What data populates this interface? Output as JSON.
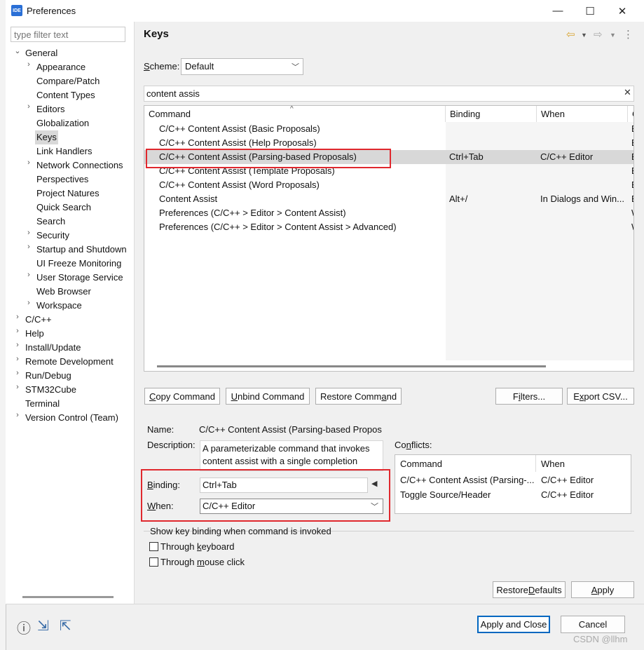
{
  "window": {
    "title": "Preferences",
    "app_icon_text": "IDE",
    "minimize": "—",
    "maximize": "☐",
    "close": "✕"
  },
  "filter": {
    "placeholder": "type filter text"
  },
  "tree": [
    {
      "label": "General",
      "level": 0,
      "twisty": "expanded"
    },
    {
      "label": "Appearance",
      "level": 1,
      "twisty": "collapsed"
    },
    {
      "label": "Compare/Patch",
      "level": 1,
      "twisty": "none"
    },
    {
      "label": "Content Types",
      "level": 1,
      "twisty": "none"
    },
    {
      "label": "Editors",
      "level": 1,
      "twisty": "collapsed"
    },
    {
      "label": "Globalization",
      "level": 1,
      "twisty": "none"
    },
    {
      "label": "Keys",
      "level": 1,
      "twisty": "none",
      "selected": true
    },
    {
      "label": "Link Handlers",
      "level": 1,
      "twisty": "none"
    },
    {
      "label": "Network Connections",
      "level": 1,
      "twisty": "collapsed"
    },
    {
      "label": "Perspectives",
      "level": 1,
      "twisty": "none"
    },
    {
      "label": "Project Natures",
      "level": 1,
      "twisty": "none"
    },
    {
      "label": "Quick Search",
      "level": 1,
      "twisty": "none"
    },
    {
      "label": "Search",
      "level": 1,
      "twisty": "none"
    },
    {
      "label": "Security",
      "level": 1,
      "twisty": "collapsed"
    },
    {
      "label": "Startup and Shutdown",
      "level": 1,
      "twisty": "collapsed"
    },
    {
      "label": "UI Freeze Monitoring",
      "level": 1,
      "twisty": "none"
    },
    {
      "label": "User Storage Service",
      "level": 1,
      "twisty": "collapsed"
    },
    {
      "label": "Web Browser",
      "level": 1,
      "twisty": "none"
    },
    {
      "label": "Workspace",
      "level": 1,
      "twisty": "collapsed"
    },
    {
      "label": "C/C++",
      "level": 0,
      "twisty": "collapsed"
    },
    {
      "label": "Help",
      "level": 0,
      "twisty": "collapsed"
    },
    {
      "label": "Install/Update",
      "level": 0,
      "twisty": "collapsed"
    },
    {
      "label": "Remote Development",
      "level": 0,
      "twisty": "collapsed"
    },
    {
      "label": "Run/Debug",
      "level": 0,
      "twisty": "collapsed"
    },
    {
      "label": "STM32Cube",
      "level": 0,
      "twisty": "collapsed"
    },
    {
      "label": "Terminal",
      "level": 0,
      "twisty": "none"
    },
    {
      "label": "Version Control (Team)",
      "level": 0,
      "twisty": "collapsed"
    }
  ],
  "page": {
    "title": "Keys"
  },
  "scheme": {
    "label_pre": "",
    "label_u": "S",
    "label_post": "cheme:",
    "value": "Default"
  },
  "search": {
    "value": "content assis"
  },
  "table": {
    "headers": [
      "Command",
      "Binding",
      "When",
      "C"
    ],
    "rows": [
      {
        "command": "C/C++ Content Assist (Basic Proposals)",
        "binding": "",
        "when": "",
        "cat": "E"
      },
      {
        "command": "C/C++ Content Assist (Help Proposals)",
        "binding": "",
        "when": "",
        "cat": "E"
      },
      {
        "command": "C/C++ Content Assist (Parsing-based Proposals)",
        "binding": "Ctrl+Tab",
        "when": "C/C++ Editor",
        "cat": "E"
      },
      {
        "command": "C/C++ Content Assist (Template Proposals)",
        "binding": "",
        "when": "",
        "cat": "E"
      },
      {
        "command": "C/C++ Content Assist (Word Proposals)",
        "binding": "",
        "when": "",
        "cat": "E"
      },
      {
        "command": "Content Assist",
        "binding": "Alt+/",
        "when": "In Dialogs and Win...",
        "cat": "E"
      },
      {
        "command": "Preferences (C/C++ > Editor > Content Assist)",
        "binding": "",
        "when": "",
        "cat": "W"
      },
      {
        "command": "Preferences (C/C++ > Editor > Content Assist > Advanced)",
        "binding": "",
        "when": "",
        "cat": "W"
      }
    ]
  },
  "buttons": {
    "copy": {
      "pre": "",
      "u": "C",
      "post": "opy Command"
    },
    "unbind": {
      "pre": "",
      "u": "U",
      "post": "nbind Command"
    },
    "restore": {
      "pre": "Restore Comm",
      "u": "a",
      "post": "nd"
    },
    "filters": {
      "pre": "F",
      "u": "i",
      "post": "lters..."
    },
    "export": {
      "pre": "E",
      "u": "x",
      "post": "port CSV..."
    },
    "restore_defaults": {
      "pre": "Restore ",
      "u": "D",
      "post": "efaults"
    },
    "apply": {
      "pre": "",
      "u": "A",
      "post": "pply"
    },
    "apply_close": "Apply and Close",
    "cancel": "Cancel"
  },
  "details": {
    "name_label": "Name:",
    "name_value": "C/C++ Content Assist (Parsing-based Propos",
    "description_label": "Description:",
    "description_value": "A parameterizable command that invokes content assist with a single completion proposal category",
    "binding_label_u": "B",
    "binding_label_post": "inding:",
    "binding_value": "Ctrl+Tab",
    "binding_button": "◀",
    "when_label_u": "W",
    "when_label_post": "hen:",
    "when_value": "C/C++ Editor"
  },
  "conflicts": {
    "label_pre": "Co",
    "label_u": "n",
    "label_post": "flicts:",
    "headers": [
      "Command",
      "When"
    ],
    "rows": [
      {
        "command": "C/C++ Content Assist (Parsing-...",
        "when": "C/C++ Editor"
      },
      {
        "command": "Toggle Source/Header",
        "when": "C/C++ Editor"
      }
    ]
  },
  "showkey": {
    "title": "Show key binding when command is invoked",
    "keyboard": {
      "pre": "Through ",
      "u": "k",
      "post": "eyboard"
    },
    "mouse": {
      "pre": "Through ",
      "u": "m",
      "post": "ouse click"
    }
  },
  "watermark": "CSDN @llhm",
  "colors": {
    "highlight": "#e0282e",
    "accent": "#0067c0"
  }
}
